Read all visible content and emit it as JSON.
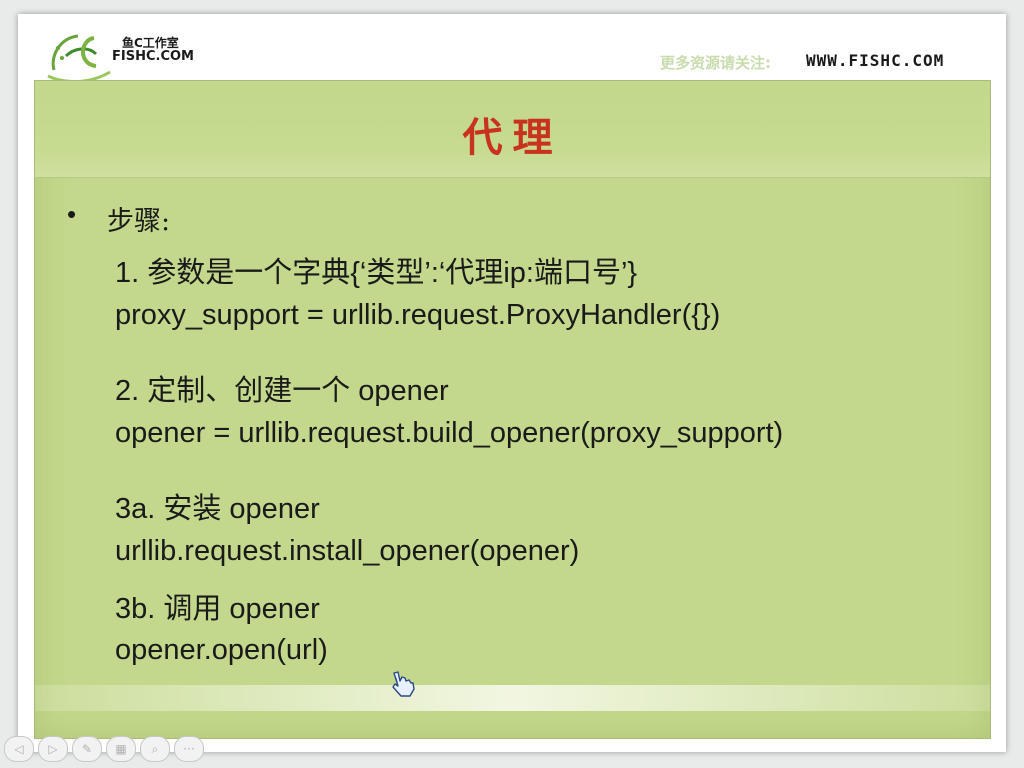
{
  "header": {
    "logo_cn": "鱼C工作室",
    "logo_en": "FISHC.COM",
    "note": "更多资源请关注:",
    "url": "WWW.FISHC.COM"
  },
  "slide": {
    "title": "代理",
    "bullet": "•",
    "steps_label": "步骤:",
    "lines": [
      "1. 参数是一个字典{‘类型’:‘代理ip:端口号’}",
      "proxy_support = urllib.request.ProxyHandler({})",
      "2. 定制、创建一个 opener",
      "opener = urllib.request.build_opener(proxy_support)",
      "3a. 安装 opener",
      "urllib.request.install_opener(opener)",
      "3b. 调用 opener",
      "opener.open(url)"
    ]
  },
  "controls": {
    "prev": "◁",
    "play": "▷",
    "pen": "✎",
    "slides": "▦",
    "zoom": "⌕",
    "more": "···"
  },
  "colors": {
    "panel": "#c3d88c",
    "title": "#c8321e",
    "text": "#1a1a1a"
  }
}
